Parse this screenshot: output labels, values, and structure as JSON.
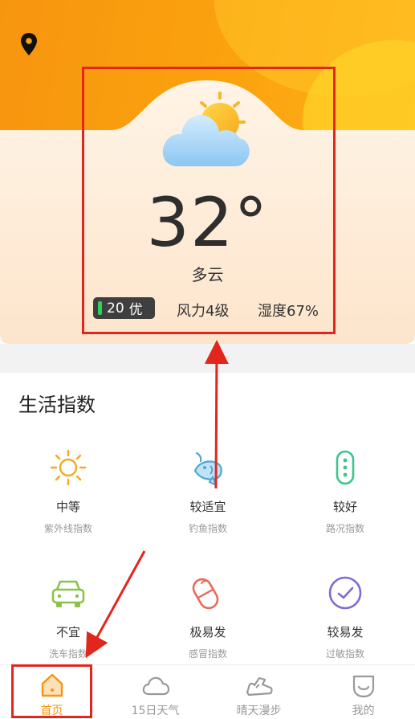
{
  "weather": {
    "temperature": "32°",
    "condition": "多云",
    "aqi_value": "20",
    "aqi_level": "优",
    "wind": "风力4级",
    "humidity": "湿度67%"
  },
  "life_index": {
    "title": "生活指数",
    "items": [
      {
        "value": "中等",
        "name": "紫外线指数",
        "icon": "sun-icon"
      },
      {
        "value": "较适宜",
        "name": "钓鱼指数",
        "icon": "fish-icon"
      },
      {
        "value": "较好",
        "name": "路况指数",
        "icon": "traffic-light-icon"
      },
      {
        "value": "不宜",
        "name": "洗车指数",
        "icon": "car-icon"
      },
      {
        "value": "极易发",
        "name": "感冒指数",
        "icon": "pill-icon"
      },
      {
        "value": "较易发",
        "name": "过敏指数",
        "icon": "allergy-check-icon"
      }
    ]
  },
  "nav": {
    "items": [
      {
        "label": "首页",
        "icon": "home-icon",
        "active": true
      },
      {
        "label": "15日天气",
        "icon": "cloud-icon",
        "active": false
      },
      {
        "label": "晴天漫步",
        "icon": "shoe-icon",
        "active": false
      },
      {
        "label": "我的",
        "icon": "profile-icon",
        "active": false
      }
    ]
  },
  "colors": {
    "accent": "#f7950f",
    "annotation_red": "#e3261d"
  }
}
